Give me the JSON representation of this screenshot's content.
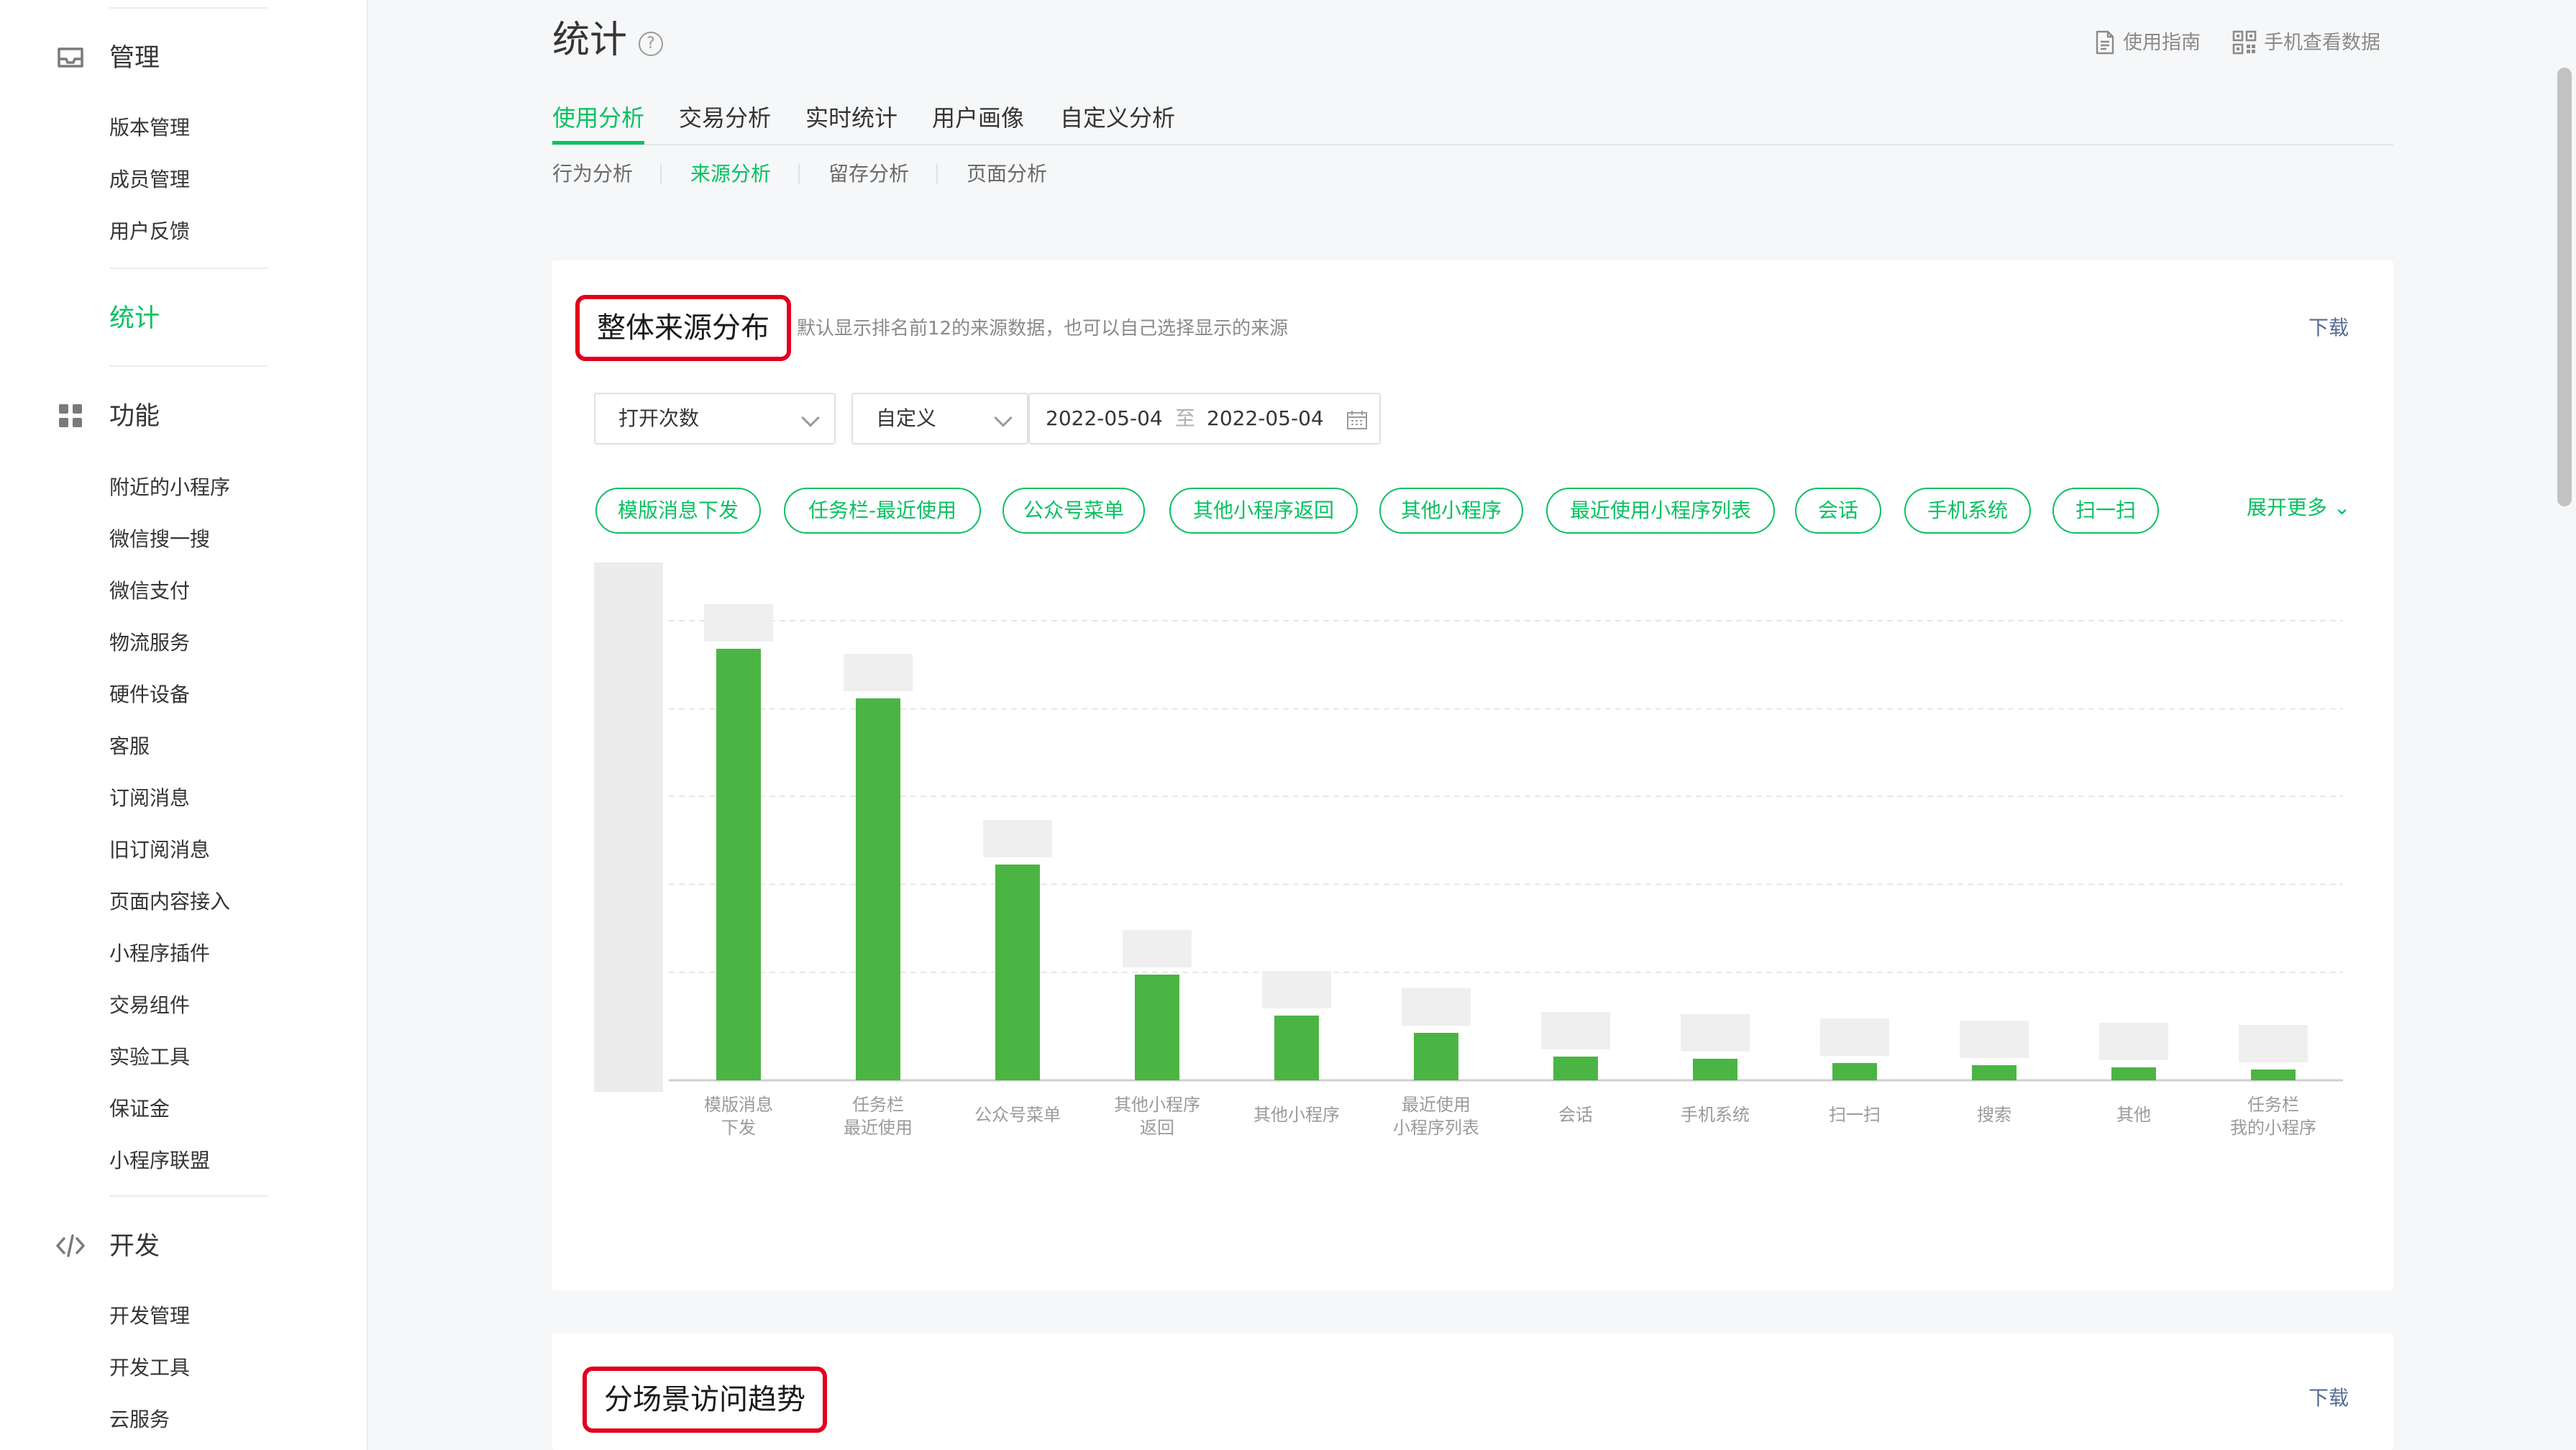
{
  "sidebar": {
    "groups": [
      {
        "title": "管理",
        "icon": "inbox-icon",
        "items": [
          "版本管理",
          "成员管理",
          "用户反馈"
        ]
      },
      {
        "title": "统计",
        "active": true,
        "items": []
      },
      {
        "title": "功能",
        "icon": "grid-icon",
        "items": [
          "附近的小程序",
          "微信搜一搜",
          "微信支付",
          "物流服务",
          "硬件设备",
          "客服",
          "订阅消息",
          "旧订阅消息",
          "页面内容接入",
          "小程序插件",
          "交易组件",
          "实验工具",
          "保证金",
          "小程序联盟"
        ]
      },
      {
        "title": "开发",
        "icon": "code-icon",
        "items": [
          "开发管理",
          "开发工具",
          "云服务"
        ]
      }
    ]
  },
  "header": {
    "title": "统计",
    "help_icon": "question-circle-icon",
    "guide_label": "使用指南",
    "guide_icon": "document-icon",
    "mobile_label": "手机查看数据",
    "mobile_icon": "qrcode-icon"
  },
  "tabs": {
    "main": [
      "使用分析",
      "交易分析",
      "实时统计",
      "用户画像",
      "自定义分析"
    ],
    "main_active": "使用分析",
    "sub": [
      "行为分析",
      "来源分析",
      "留存分析",
      "页面分析"
    ],
    "sub_active": "来源分析"
  },
  "card1": {
    "title": "整体来源分布",
    "desc": "默认显示排名前12的来源数据，也可以自己选择显示的来源",
    "download": "下载",
    "metric_select": "打开次数",
    "range_select": "自定义",
    "date_start": "2022-05-04",
    "date_sep": "至",
    "date_end": "2022-05-04",
    "tags": [
      "模版消息下发",
      "任务栏-最近使用",
      "公众号菜单",
      "其他小程序返回",
      "其他小程序",
      "最近使用小程序列表",
      "会话",
      "手机系统",
      "扫一扫"
    ],
    "expand_more": "展开更多"
  },
  "card2": {
    "title": "分场景访问趋势",
    "download": "下载"
  },
  "colors": {
    "accent": "#07c160",
    "bar": "#4bb543",
    "link": "#576b95",
    "highlight": "#e0001b"
  },
  "chart_data": {
    "type": "bar",
    "categories": [
      [
        "模版消息",
        "下发"
      ],
      [
        "任务栏",
        "最近使用"
      ],
      [
        "公众号菜单"
      ],
      [
        "其他小程序",
        "返回"
      ],
      [
        "其他小程序"
      ],
      [
        "最近使用",
        "小程序列表"
      ],
      [
        "会话"
      ],
      [
        "手机系统"
      ],
      [
        "扫一扫"
      ],
      [
        "搜索"
      ],
      [
        "其他"
      ],
      [
        "任务栏",
        "我的小程序"
      ]
    ],
    "values": [
      100,
      88.5,
      50,
      24.5,
      15,
      11,
      5.5,
      5,
      4,
      3.5,
      3,
      2.5
    ],
    "ylim": [
      0,
      120
    ],
    "grid": true,
    "legend": "none"
  }
}
